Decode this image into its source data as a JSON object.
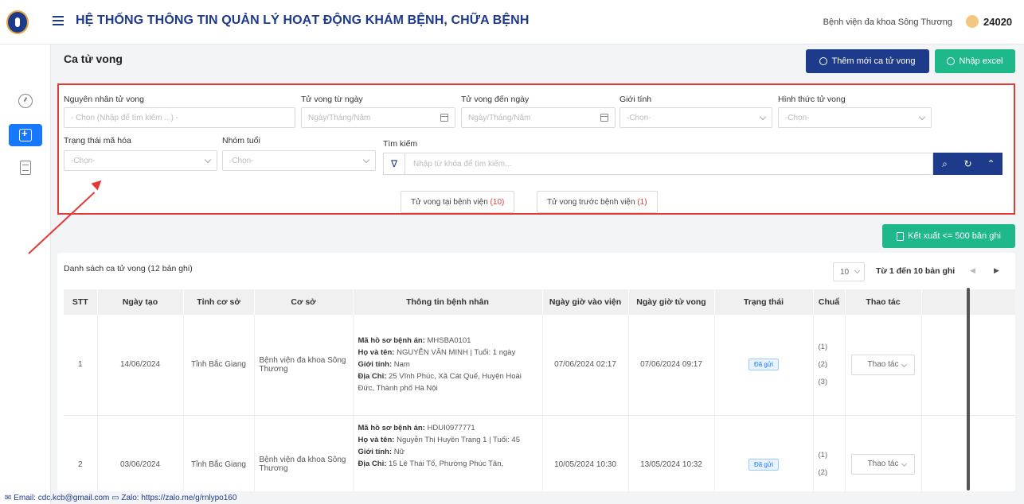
{
  "header": {
    "title": "HỆ THỐNG THÔNG TIN QUẢN LÝ HOẠT ĐỘNG KHÁM BỆNH, CHỮA BỆNH",
    "hospital": "Bệnh viện đa khoa Sông Thương",
    "user_id": "24020"
  },
  "page": {
    "title": "Ca tử vong",
    "add_label": "Thêm mới ca tử vong",
    "import_label": "Nhập excel",
    "export_label": "Kết xuất <= 500 bản ghi"
  },
  "filters": {
    "cause_label": "Nguyên nhân tử vong",
    "cause_placeholder": "- Chọn (Nhập để tìm kiếm ...) -",
    "from_label": "Tử vong từ ngày",
    "from_placeholder": "Ngày/Tháng/Năm",
    "to_label": "Tử vong đến ngày",
    "to_placeholder": "Ngày/Tháng/Năm",
    "gender_label": "Giới tính",
    "gender_placeholder": "-Chọn-",
    "form_label": "Hình thức tử vong",
    "form_placeholder": "-Chọn-",
    "encode_label": "Trạng thái mã hóa",
    "encode_placeholder": "-Chọn-",
    "age_label": "Nhóm tuổi",
    "age_placeholder": "-Chọn-",
    "search_label": "Tìm kiếm",
    "search_placeholder": "Nhập từ khóa để tìm kiếm...",
    "quick": [
      {
        "label": "Tử vong tại bệnh viện",
        "count": "(10)"
      },
      {
        "label": "Tử vong trước bệnh viện",
        "count": "(1)"
      }
    ]
  },
  "list": {
    "title": "Danh sách ca tử vong (12 bản ghi)",
    "page_size": "10",
    "range": "Từ 1 đến 10 bản ghi",
    "columns": [
      "STT",
      "Ngày tạo",
      "Tỉnh cơ sở",
      "Cơ sở",
      "Thông tin bệnh nhân",
      "Ngày giờ vào viện",
      "Ngày giờ tử vong",
      "Trạng thái",
      "Chuẩ",
      "Thao tác"
    ],
    "rows": [
      {
        "stt": "1",
        "created": "14/06/2024",
        "province": "Tỉnh Bắc Giang",
        "facility": "Bệnh viện đa khoa Sông Thương",
        "record_label": "Mã hồ sơ bệnh án:",
        "record": "MHSBA0101",
        "name_label": "Họ và tên:",
        "name": "NGUYỄN VĂN MINH | Tuổi: 1 ngày",
        "gender_label": "Giới tính:",
        "gender": "Nam",
        "address_label": "Địa Chỉ:",
        "address": "25 Vĩnh Phúc, Xã Cát Quế, Huyện Hoài Đức, Thành phố Hà Nội",
        "admitted": "07/06/2024 02:17",
        "died": "07/06/2024 09:17",
        "status": "Đã gửi",
        "chu": [
          "(1)",
          "(2)",
          "(3)"
        ],
        "action": "Thao tác"
      },
      {
        "stt": "2",
        "created": "03/06/2024",
        "province": "Tỉnh Bắc Giang",
        "facility": "Bệnh viện đa khoa Sông Thương",
        "record_label": "Mã hồ sơ bệnh án:",
        "record": "HDUI0977771",
        "name_label": "Họ và tên:",
        "name": "Nguyễn Thị Huyền Trang 1 | Tuổi: 45",
        "gender_label": "Giới tính:",
        "gender": "Nữ",
        "address_label": "Địa Chỉ:",
        "address": "15 Lê Thái Tổ, Phường Phúc Tân,",
        "admitted": "10/05/2024 10:30",
        "died": "13/05/2024 10:32",
        "status": "Đã gửi",
        "chu": [
          "(1)",
          "(2)"
        ],
        "action": "Thao tác"
      }
    ]
  },
  "footer": {
    "text": "✉ Email: cdc.kcb@gmail.com  ▭ Zalo: https://zalo.me/g/rnlypo160"
  },
  "colors": {
    "primary": "#1e3a8a",
    "accent_blue": "#1677ff",
    "green": "#1fb88a",
    "highlight_red": "#e53935"
  }
}
